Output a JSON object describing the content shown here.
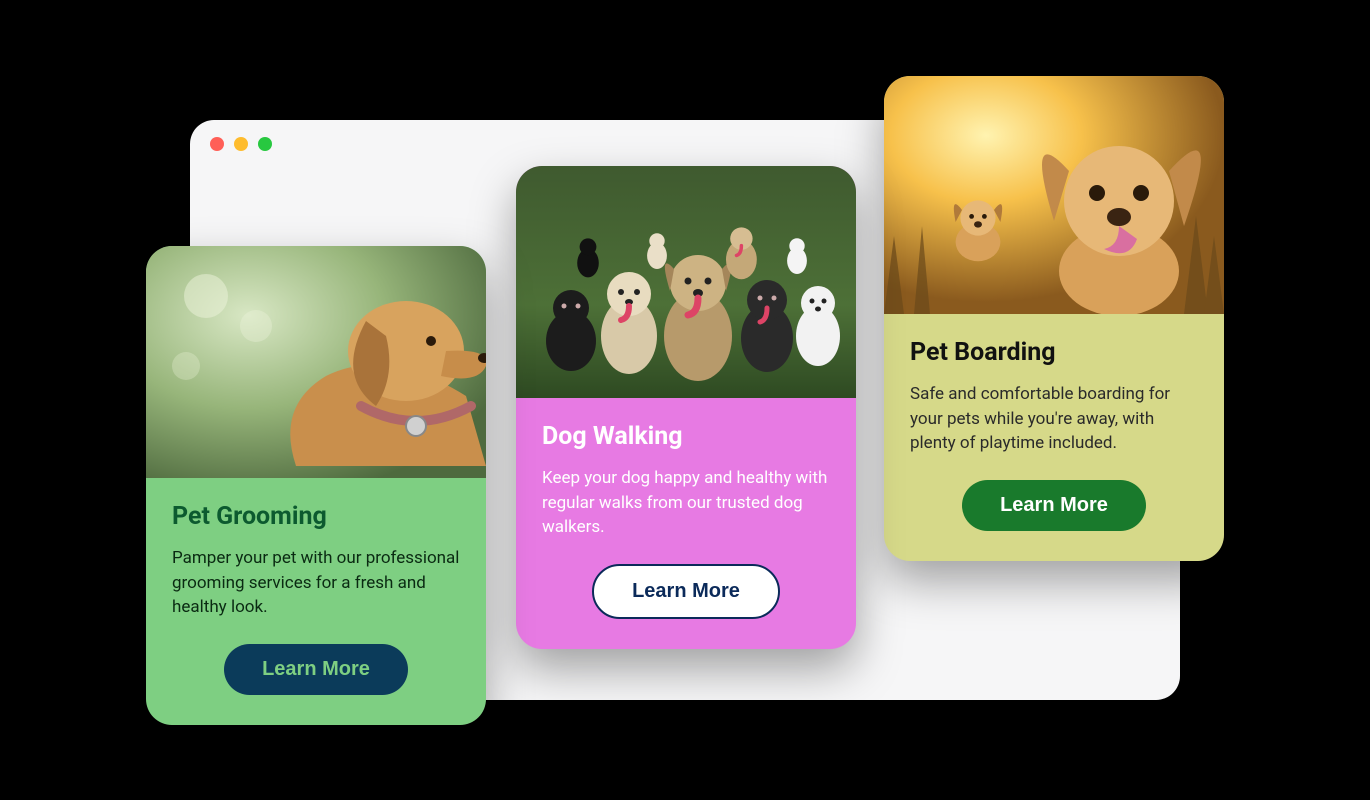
{
  "browser": {
    "traffic_lights": [
      "close",
      "minimize",
      "zoom"
    ]
  },
  "cards": {
    "grooming": {
      "title": "Pet Grooming",
      "description": "Pamper your pet with our professional grooming services for a fresh and healthy look.",
      "button": "Learn More",
      "image_alt": "golden-retriever-profile",
      "colors": {
        "bg": "#7ecf82",
        "heading": "#0c5a2f",
        "button_bg": "#0b3b5a"
      }
    },
    "walking": {
      "title": "Dog Walking",
      "description": "Keep your dog happy and healthy with regular walks from our trusted dog walkers.",
      "button": "Learn More",
      "image_alt": "group-of-dogs-on-grass",
      "colors": {
        "bg": "#e77ae3",
        "heading": "#ffffff",
        "button_bg": "#ffffff"
      }
    },
    "boarding": {
      "title": "Pet Boarding",
      "description": "Safe and comfortable boarding for your pets while you're away, with plenty of playtime included.",
      "button": "Learn More",
      "image_alt": "puppies-running-sunset",
      "colors": {
        "bg": "#d6d989",
        "heading": "#111111",
        "button_bg": "#197a2c"
      }
    }
  }
}
